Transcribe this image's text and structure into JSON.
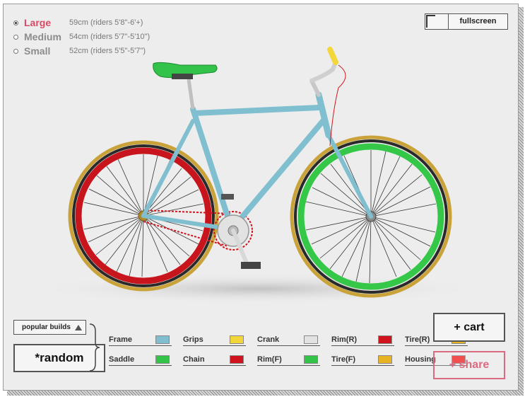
{
  "sizes": [
    {
      "name": "Large",
      "desc": "59cm (riders 5'8\"-6'+)",
      "selected": true
    },
    {
      "name": "Medium",
      "desc": "54cm (riders 5'7\"-5'10\")",
      "selected": false
    },
    {
      "name": "Small",
      "desc": "52cm (riders 5'5\"-5'7\")",
      "selected": false
    }
  ],
  "fullscreen_label": "fullscreen",
  "popular_builds_label": "popular builds",
  "random_label": "*random",
  "cart_label": "+ cart",
  "share_label": "+ share",
  "parts": [
    {
      "label": "Frame",
      "color": "#7fbfcf"
    },
    {
      "label": "Grips",
      "color": "#f2d63a"
    },
    {
      "label": "Crank",
      "color": "#e2e2e2"
    },
    {
      "label": "Rim(R)",
      "color": "#d0141e"
    },
    {
      "label": "Tire(R)",
      "color": "#e8b323"
    },
    {
      "label": "Saddle",
      "color": "#33c24a"
    },
    {
      "label": "Chain",
      "color": "#d0141e"
    },
    {
      "label": "Rim(F)",
      "color": "#33c24a"
    },
    {
      "label": "Tire(F)",
      "color": "#e8b323"
    },
    {
      "label": "Housing",
      "color": "#f21818"
    }
  ],
  "colors": {
    "accent": "#d94b63",
    "frame": "#7fbfcf",
    "saddle": "#33c24a",
    "rim_rear": "#c8141c",
    "rim_front": "#34c748",
    "tire": "#c9a23a",
    "chain": "#d0141e",
    "grips": "#f2d63a"
  }
}
